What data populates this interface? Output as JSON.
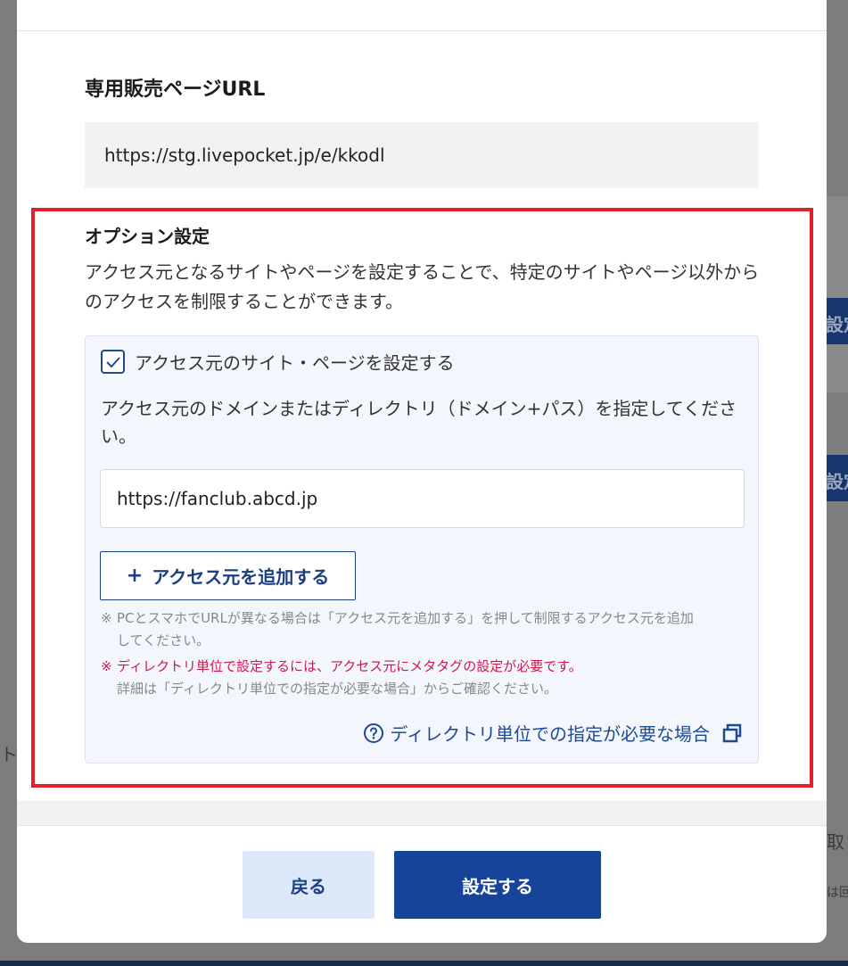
{
  "background": {
    "button_1": "設定",
    "button_2": "設定",
    "left_text": "ト",
    "right_text_1": "取り",
    "right_text_2": "は回"
  },
  "modal": {
    "sales_url_title": "専用販売ページURL",
    "sales_url": "https://stg.livepocket.jp/e/kkodl",
    "option": {
      "title": "オプション設定",
      "description": "アクセス元となるサイトやページを設定することで、特定のサイトやページ以外からのアクセスを制限することができます。",
      "checkbox_label": "アクセス元のサイト・ページを設定する",
      "checkbox_checked": true,
      "domain_instruction": "アクセス元のドメインまたはディレクトリ（ドメイン+パス）を指定してください。",
      "domain_value": "https://fanclub.abcd.jp",
      "add_button_plus": "+",
      "add_button_label": "アクセス元を追加する",
      "note1_mark": "※",
      "note1_line1": "PCとスマホでURLが異なる場合は「アクセス元を追加する」を押して制限するアクセス元を追加",
      "note1_line2": "してください。",
      "note2_mark": "※",
      "note2_red": "ディレクトリ単位で設定するには、アクセス元にメタタグの設定が必要です。",
      "note2_line2": "詳細は「ディレクトリ単位での指定が必要な場合」からご確認ください。",
      "help_link_label": "ディレクトリ単位での指定が必要な場合"
    },
    "footer": {
      "back_label": "戻る",
      "submit_label": "設定する"
    }
  },
  "colors": {
    "primary": "#17449b",
    "highlight_frame": "#e0202a",
    "warning_text": "#cc1b4b",
    "panel_bg": "#f3f6fc"
  }
}
